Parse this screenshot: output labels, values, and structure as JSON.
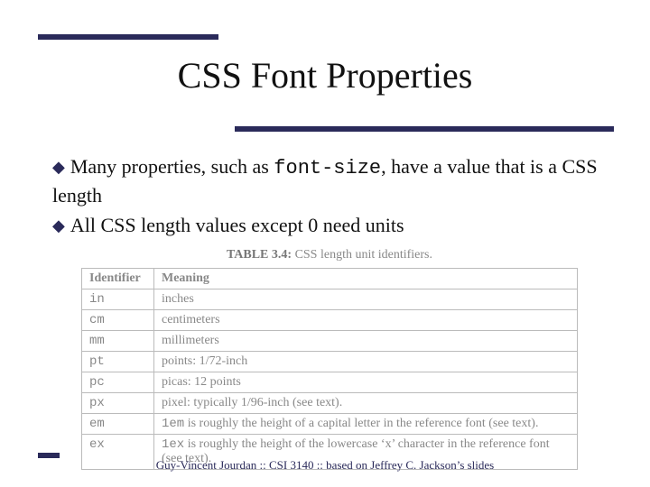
{
  "title": "CSS Font Properties",
  "bullets": {
    "b1_pre": "Many properties, such as ",
    "b1_code": "font-size",
    "b1_post": ", have a value that is a CSS length",
    "b2": "All CSS length values except 0 need units"
  },
  "table": {
    "caption_label": "TABLE 3.4:",
    "caption_text": " CSS length unit identifiers.",
    "headers": {
      "id": "Identifier",
      "meaning": "Meaning"
    },
    "rows": [
      {
        "id": "in",
        "meaning": "inches"
      },
      {
        "id": "cm",
        "meaning": "centimeters"
      },
      {
        "id": "mm",
        "meaning": "millimeters"
      },
      {
        "id": "pt",
        "meaning": "points: 1/72-inch"
      },
      {
        "id": "pc",
        "meaning": "picas: 12 points"
      },
      {
        "id": "px",
        "meaning": "pixel: typically 1/96-inch (see text)."
      },
      {
        "id": "em",
        "meaning_pre": "",
        "meaning_code": "1em",
        "meaning_post": " is roughly the height of a capital letter in the reference font (see text)."
      },
      {
        "id": "ex",
        "meaning_pre": "",
        "meaning_code": "1ex",
        "meaning_post": " is roughly the height of the lowercase ‘x’ character in the reference font (see text)."
      }
    ]
  },
  "footer": "Guy-Vincent Jourdan :: CSI 3140 :: based on Jeffrey C. Jackson’s slides"
}
